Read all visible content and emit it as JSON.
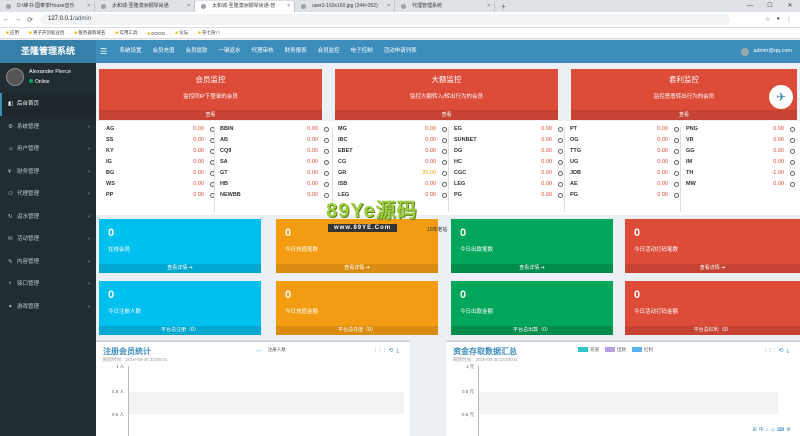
{
  "browser": {
    "tabs": [
      {
        "label": "D:\\维书-国奉茶House音乐"
      },
      {
        "label": "太和城-圣隆澳洲钢琴尚通"
      },
      {
        "label": "太和城-圣隆澳洲钢琴尚通-管·"
      },
      {
        "label": "user2-160x160.jpg (244×352)"
      },
      {
        "label": "代理管理系统"
      }
    ],
    "active_tab": 2,
    "url_host": "127.0.0.1",
    "url_path": "/admin",
    "bookmarks": [
      "应用",
      "男子开创就业创",
      "服务器和域名",
      "实用工具",
      "DOOG",
      "论坛",
      "杂七杂八"
    ]
  },
  "app": {
    "title": "圣隆管理系统",
    "menu": [
      "系统设置",
      "会员充值",
      "会员提款",
      "一键返水",
      "代理审核",
      "财务报表",
      "会员监控",
      "电子控制",
      "活动申请列表"
    ],
    "user_email": "admin@qq.com",
    "profile_name": "Alexander Pierce",
    "profile_status": "Online"
  },
  "sidebar": {
    "items": [
      {
        "label": "后台首页",
        "icon": "dashboard-icon"
      },
      {
        "label": "系统管理",
        "icon": "gear-icon"
      },
      {
        "label": "用户管理",
        "icon": "user-icon"
      },
      {
        "label": "财务管理",
        "icon": "money-icon"
      },
      {
        "label": "代理管理",
        "icon": "group-icon"
      },
      {
        "label": "返水管理",
        "icon": "refresh-icon"
      },
      {
        "label": "活动管理",
        "icon": "gift-icon"
      },
      {
        "label": "内容管理",
        "icon": "edit-icon"
      },
      {
        "label": "接口管理",
        "icon": "plug-icon"
      },
      {
        "label": "游戏管理",
        "icon": "gamepad-icon"
      }
    ]
  },
  "monitors": [
    {
      "title": "会员监控",
      "desc": "监控同IP下登录的会员",
      "footer": "查看"
    },
    {
      "title": "大额监控",
      "desc": "监控大额转入/转出行为的会员",
      "footer": "查看"
    },
    {
      "title": "套利监控",
      "desc": "监控恶意转出行为的会员",
      "footer": "查看"
    }
  ],
  "games": [
    [
      {
        "n": "AG",
        "v": "0.00"
      },
      {
        "n": "SS",
        "v": "0.00"
      },
      {
        "n": "KY",
        "v": "0.00"
      },
      {
        "n": "IG",
        "v": "0.00"
      },
      {
        "n": "BG",
        "v": "0.00"
      },
      {
        "n": "WS",
        "v": "0.00"
      },
      {
        "n": "PP",
        "v": "0.00"
      }
    ],
    [
      {
        "n": "BBIN",
        "v": "0.00"
      },
      {
        "n": "AB",
        "v": "0.00"
      },
      {
        "n": "CQ9",
        "v": "0.00"
      },
      {
        "n": "SA",
        "v": "0.00"
      },
      {
        "n": "GT",
        "v": "0.00"
      },
      {
        "n": "HB",
        "v": "0.00"
      },
      {
        "n": "NEWBB",
        "v": "0.00"
      }
    ],
    [
      {
        "n": "MG",
        "v": "0.00"
      },
      {
        "n": "IBC",
        "v": "0.00"
      },
      {
        "n": "EBET",
        "v": "0.00"
      },
      {
        "n": "CG",
        "v": "0.00"
      },
      {
        "n": "GR",
        "v": "20.00"
      },
      {
        "n": "ISB",
        "v": "0.00"
      },
      {
        "n": "LEG",
        "v": "0.00"
      }
    ],
    [
      {
        "n": "EG",
        "v": "0.00"
      },
      {
        "n": "SUNBET",
        "v": "0.00"
      },
      {
        "n": "DG",
        "v": "0.00"
      },
      {
        "n": "HC",
        "v": "0.00"
      },
      {
        "n": "CGC",
        "v": "0.00"
      },
      {
        "n": "LEG",
        "v": "0.00"
      },
      {
        "n": "PG",
        "v": "0.00"
      }
    ],
    [
      {
        "n": "PT",
        "v": "0.00"
      },
      {
        "n": "OG",
        "v": "0.00"
      },
      {
        "n": "TTG",
        "v": "0.00"
      },
      {
        "n": "UG",
        "v": "0.00"
      },
      {
        "n": "JDB",
        "v": "0.00"
      },
      {
        "n": "AE",
        "v": "0.00"
      },
      {
        "n": "PG",
        "v": "0.00"
      }
    ],
    [
      {
        "n": "PNG",
        "v": "0.00"
      },
      {
        "n": "VR",
        "v": "0.00"
      },
      {
        "n": "GG",
        "v": "0.00"
      },
      {
        "n": "IM",
        "v": "0.00"
      },
      {
        "n": "TH",
        "v": "-1.00"
      },
      {
        "n": "MW",
        "v": "0.00"
      }
    ]
  ],
  "stats_row1": [
    {
      "value": "0",
      "label": "在线会员",
      "footer": "查看详情 ➔"
    },
    {
      "value": "0",
      "label": "今日充值笔数",
      "footer": "查看详情 ➔"
    },
    {
      "value": "0",
      "label": "今日出款笔数",
      "footer": "查看详情 ➔"
    },
    {
      "value": "0",
      "label": "今日活动打码笔数",
      "footer": "查看详情 ➔"
    }
  ],
  "stats_row2": [
    {
      "value": "0",
      "label": "今日注册人数",
      "footer": "平台总注册（0）"
    },
    {
      "value": "0",
      "label": "今日充值金额",
      "footer": "平台总充值（0）"
    },
    {
      "value": "0",
      "label": "今日出款金额",
      "footer": "平台总出款（0）"
    },
    {
      "value": "0",
      "label": "今日活动打码金额",
      "footer": "平台总红利（0）"
    }
  ],
  "panel_left": {
    "title": "注册会员统计",
    "date": "刷新时间：2019-09-30 23:09:01",
    "legend": "注册人数",
    "ticks": [
      "1 人",
      "0.8 人",
      "0.6 人"
    ]
  },
  "panel_right": {
    "title": "资金存取数据汇总",
    "date": "刷新时间：2019-09-30 23:09:01",
    "legend": [
      "充值",
      "出款",
      "红利"
    ],
    "ticks": [
      "1 元",
      "0.8 元",
      "0.6 元"
    ]
  },
  "watermark": {
    "main": "89Ye源码",
    "url": "www.89YE.Com",
    "tail": "10年老站"
  },
  "colors": {
    "primary": "#3c8dbc",
    "sidebar": "#222d32",
    "red": "#dd4b39",
    "aqua": "#00c0ef",
    "yellow": "#f39c12",
    "green": "#00a65a"
  }
}
